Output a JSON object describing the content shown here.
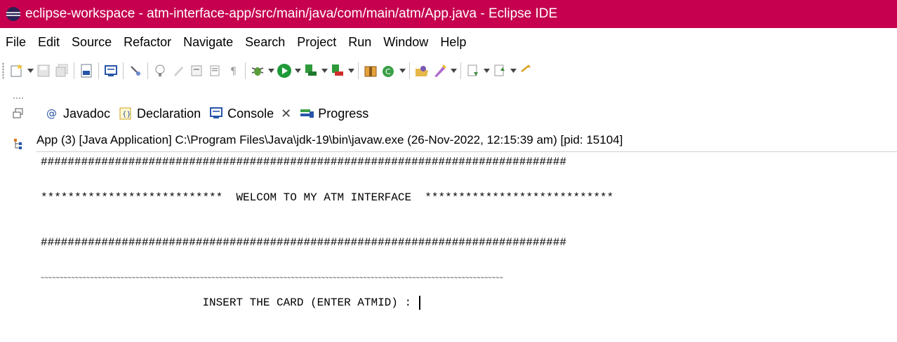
{
  "window": {
    "title": "eclipse-workspace - atm-interface-app/src/main/java/com/main/atm/App.java - Eclipse IDE"
  },
  "menu": {
    "items": [
      "File",
      "Edit",
      "Source",
      "Refactor",
      "Navigate",
      "Search",
      "Project",
      "Run",
      "Window",
      "Help"
    ]
  },
  "tabs": [
    {
      "label": "Javadoc",
      "icon": "at-sign-icon"
    },
    {
      "label": "Declaration",
      "icon": "declaration-icon"
    },
    {
      "label": "Console",
      "icon": "console-icon",
      "active": true
    },
    {
      "label": "Progress",
      "icon": "progress-icon"
    }
  ],
  "console": {
    "header": "App (3) [Java Application] C:\\Program Files\\Java\\jdk-19\\bin\\javaw.exe  (26-Nov-2022, 12:15:39 am) [pid: 15104]",
    "lines": [
      "##############################################################################",
      "***************************  WELCOM TO MY ATM INTERFACE  ****************************",
      "##############################################################################",
      "~~~~~~~~~~~~~~~~~~~~~~~~~~~~~~~~~~~~~~~~~~~~~~~~~~~~~~~~~~~~~~~~~~~~~~~~~~~~~~~~~~~~~~~~~~~~~~~~~~~~~~~~~~~~~~~~~~~~~~~~~~",
      "                        INSERT THE CARD (ENTER ATMID) : "
    ]
  },
  "colors": {
    "titlebar": "#c6004f",
    "run_green": "#1e9a3a",
    "debug_red": "#d22d2d",
    "console_blue": "#2855a8"
  }
}
